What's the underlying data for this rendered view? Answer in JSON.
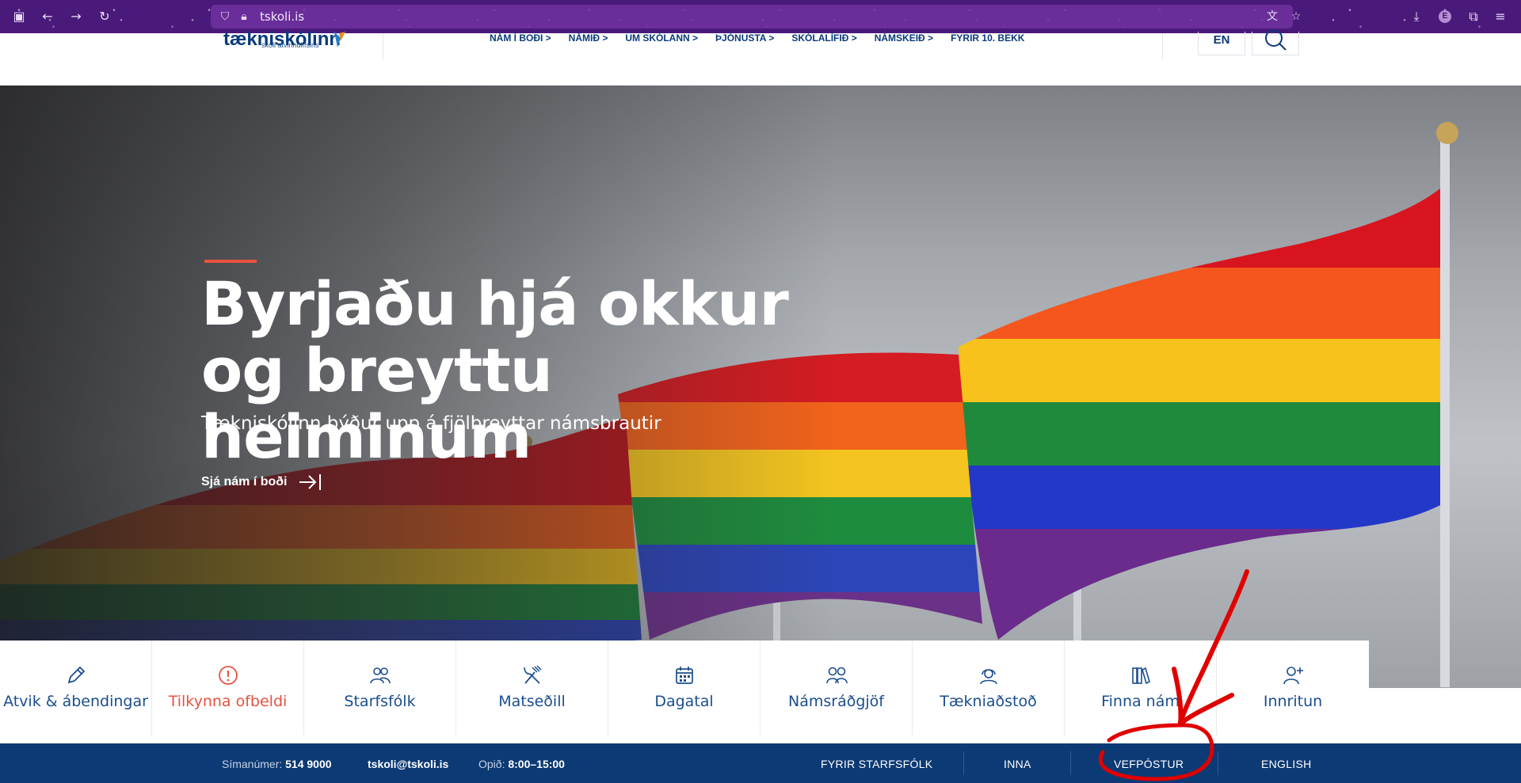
{
  "browser": {
    "url": "tskoli.is"
  },
  "header": {
    "logo_text": "tækniskólinn",
    "logo_sub": "skóli atvinnulífsins",
    "nav": [
      "NÁM Í BOÐI >",
      "NÁMIÐ >",
      "UM SKÓLANN >",
      "ÞJÓNUSTA >",
      "SKÓLALÍFIÐ >",
      "NÁMSKEIÐ >",
      "FYRIR 10. BEKK"
    ],
    "lang": "EN"
  },
  "hero": {
    "title": "Byrjaðu hjá okkur og breyttu heiminum",
    "subtitle": "Tækniskólinn býður upp á fjölbreyttar námsbrautir",
    "cta": "Sjá nám í boði"
  },
  "quick_links": [
    {
      "label": "Atvik & ábendingar",
      "icon": "pencil-icon"
    },
    {
      "label": "Tilkynna ofbeldi",
      "icon": "alert-icon"
    },
    {
      "label": "Starfsfólk",
      "icon": "people-icon"
    },
    {
      "label": "Matseðill",
      "icon": "cutlery-icon"
    },
    {
      "label": "Dagatal",
      "icon": "calendar-icon"
    },
    {
      "label": "Námsráðgjöf",
      "icon": "advisors-icon"
    },
    {
      "label": "Tækniaðstoð",
      "icon": "support-icon"
    },
    {
      "label": "Finna nám",
      "icon": "books-icon"
    },
    {
      "label": "Innritun",
      "icon": "add-user-icon"
    }
  ],
  "footer": {
    "phone_label": "Símanúmer:",
    "phone": "514 9000",
    "email": "tskoli@tskoli.is",
    "hours_label": "Opið:",
    "hours": "8:00–15:00",
    "links": [
      "FYRIR STARFSFÓLK",
      "INNA",
      "VEFPÓSTUR",
      "ENGLISH"
    ]
  },
  "colors": {
    "primary": "#0c3a74",
    "accent": "#e8523f",
    "annotation": "#e00000"
  }
}
